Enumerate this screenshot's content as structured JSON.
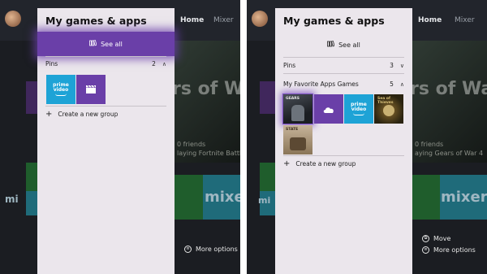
{
  "left": {
    "nav": {
      "home": "Home",
      "mixer": "Mixer"
    },
    "hero_text": "rs of War",
    "friends_line1": "0 friends",
    "friends_line2": "laying Fortnite Battle",
    "mixer_tile": "mi",
    "mixer_tile2": "mixer",
    "panel": {
      "title": "My games & apps",
      "see_all": "See all",
      "groups": [
        {
          "label": "Pins",
          "count": "2",
          "chevron": "up"
        }
      ],
      "tiles": [
        {
          "type": "prime",
          "text1": "prime",
          "text2": "video"
        },
        {
          "type": "movies-tv"
        }
      ],
      "create_group": "Create a new group"
    },
    "more_options": "More options"
  },
  "right": {
    "nav": {
      "home": "Home",
      "mixer": "Mixer"
    },
    "hero_text": "rs of War",
    "friends_line1": "0 friends",
    "friends_line2": "aying Gears of War 4",
    "mixer_tile": "mi",
    "mixer_tile2": "mixer",
    "panel": {
      "title": "My games & apps",
      "see_all": "See all",
      "groups": [
        {
          "label": "Pins",
          "count": "3",
          "chevron": "down"
        },
        {
          "label": "My Favorite Apps Games",
          "count": "5",
          "chevron": "up"
        }
      ],
      "tiles": [
        {
          "type": "gears",
          "text": "GEARS"
        },
        {
          "type": "onedrive"
        },
        {
          "type": "prime",
          "text1": "prime",
          "text2": "video"
        },
        {
          "type": "sea-of-thieves",
          "text": "Sea of Thieves"
        },
        {
          "type": "state-of-decay",
          "text": "STATE"
        }
      ],
      "create_group": "Create a new group"
    },
    "move": "Move",
    "more_options": "More options"
  },
  "colors": {
    "accent_purple": "#6a3fa8",
    "panel_bg": "#ebe6ec",
    "prime_blue": "#1ea3d6"
  }
}
